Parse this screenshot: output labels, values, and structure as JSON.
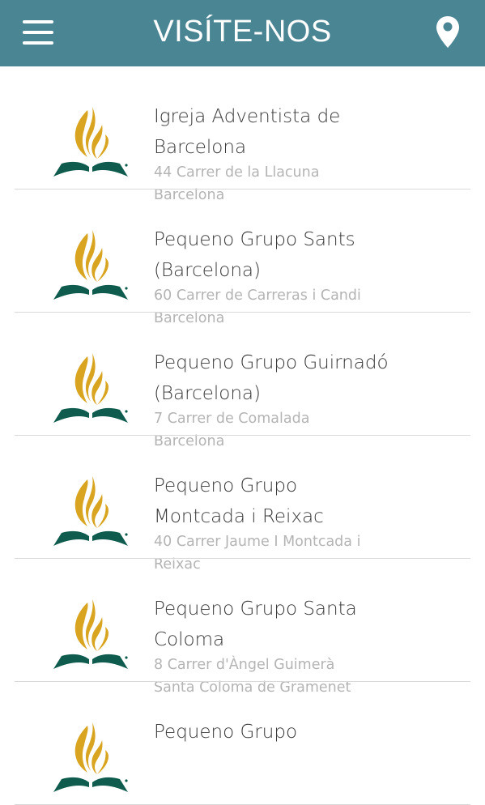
{
  "header": {
    "title": "VISÍTE-NOS",
    "menu_icon": "hamburger-menu-icon",
    "map_icon": "map-pin-icon"
  },
  "colors": {
    "header_bg": "#4a8593",
    "logo_gold": "#d9a520",
    "logo_green": "#0f5c4e"
  },
  "locations": [
    {
      "name": "Igreja Adventista de Barcelona",
      "address_line1": "44 Carrer de la Llacuna",
      "address_line2": "Barcelona"
    },
    {
      "name": "Pequeno Grupo Sants (Barcelona)",
      "address_line1": "60 Carrer de Carreras i Candi",
      "address_line2": "Barcelona"
    },
    {
      "name": "Pequeno Grupo Guirnadó (Barcelona)",
      "address_line1": "7 Carrer de Comalada",
      "address_line2": "Barcelona"
    },
    {
      "name": "Pequeno Grupo Montcada i Reixac",
      "address_line1": "40 Carrer Jaume I Montcada i",
      "address_line2": "Reixac"
    },
    {
      "name": "Pequeno Grupo Santa Coloma",
      "address_line1": "8 Carrer d'Àngel Guimerà",
      "address_line2": "Santa Coloma de Gramenet"
    },
    {
      "name": "Pequeno Grupo",
      "address_line1": "",
      "address_line2": ""
    }
  ]
}
